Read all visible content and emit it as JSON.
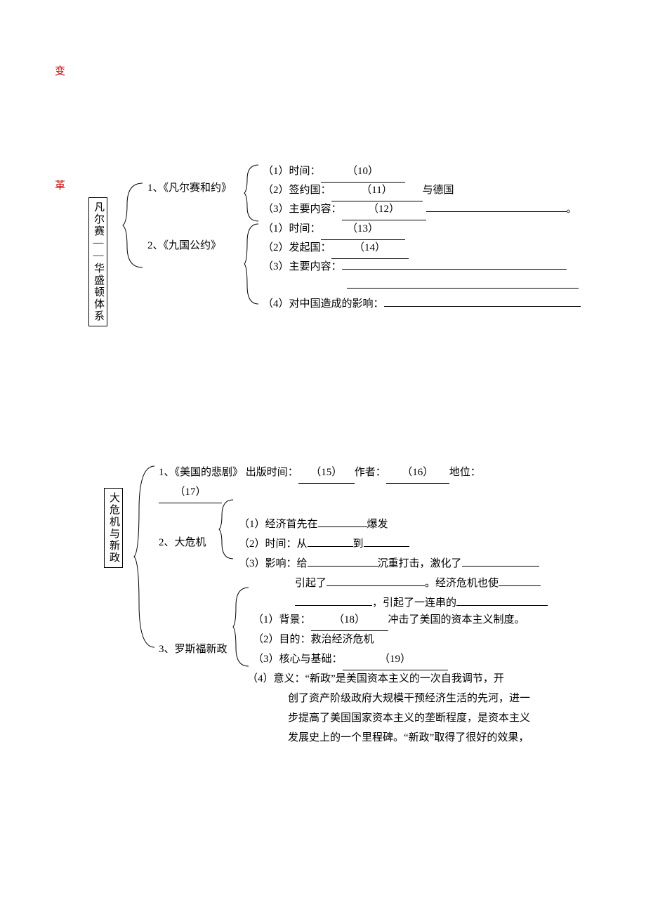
{
  "side_labels": {
    "a": "变",
    "b": "革"
  },
  "section1": {
    "box_title": "凡尔赛——华盛顿体系",
    "item1": {
      "label": "1、《凡尔赛和约》",
      "p1_a": "（1）时间：",
      "p1_blank": "（10）",
      "p2_a": "（2）签约国：",
      "p2_blank": "（11）",
      "p2_b": "与德国",
      "p3_a": "（3）主要内容：",
      "p3_blank": "（12）",
      "p3_b": "。"
    },
    "item2": {
      "label": "2、《九国公约》",
      "p1_a": "（1）时间：",
      "p1_blank": "（13）",
      "p2_a": "（2）发起国：",
      "p2_blank": "（14）",
      "p3_a": "（3）主要内容：",
      "p4_a": "（4）对中国造成的影响："
    }
  },
  "section2": {
    "box_title": "大危机与新政",
    "item1": {
      "a": "1、《美国的悲剧》  出版时间：",
      "b15": "（15）",
      "b": "作者：",
      "b16": "（16）",
      "c": "地位：",
      "b17": "（17）"
    },
    "item2": {
      "label": "2、大危机",
      "p1_a": "（1）经济首先在",
      "p1_b": "爆发",
      "p2_a": "（2）时间：从",
      "p2_b": "到",
      "p3_a": "（3）影响：给",
      "p3_b": "沉重打击，激化了",
      "p4_a": "引起了",
      "p4_b": "。经济危机也使",
      "p5_a": "，引起了一连串的"
    },
    "item3": {
      "label": "3、罗斯福新政",
      "p1_a": "（1）背景：",
      "p1_blank": "（18）",
      "p1_b": "冲击了美国的资本主义制度。",
      "p2_a": "（2）目的：救治经济危机",
      "p3_a": "（3）核心与基础：",
      "p3_blank": "（19）",
      "p4_a": "（4）意义：“新政”是美国资本主义的一次自我调节，开",
      "p4_b": "创了资产阶级政府大规模干预经济生活的先河，进一",
      "p4_c": "步提高了美国国家资本主义的垄断程度，是资本主义",
      "p4_d": "发展史上的一个里程碑。“新政”取得了很好的效果，"
    }
  }
}
